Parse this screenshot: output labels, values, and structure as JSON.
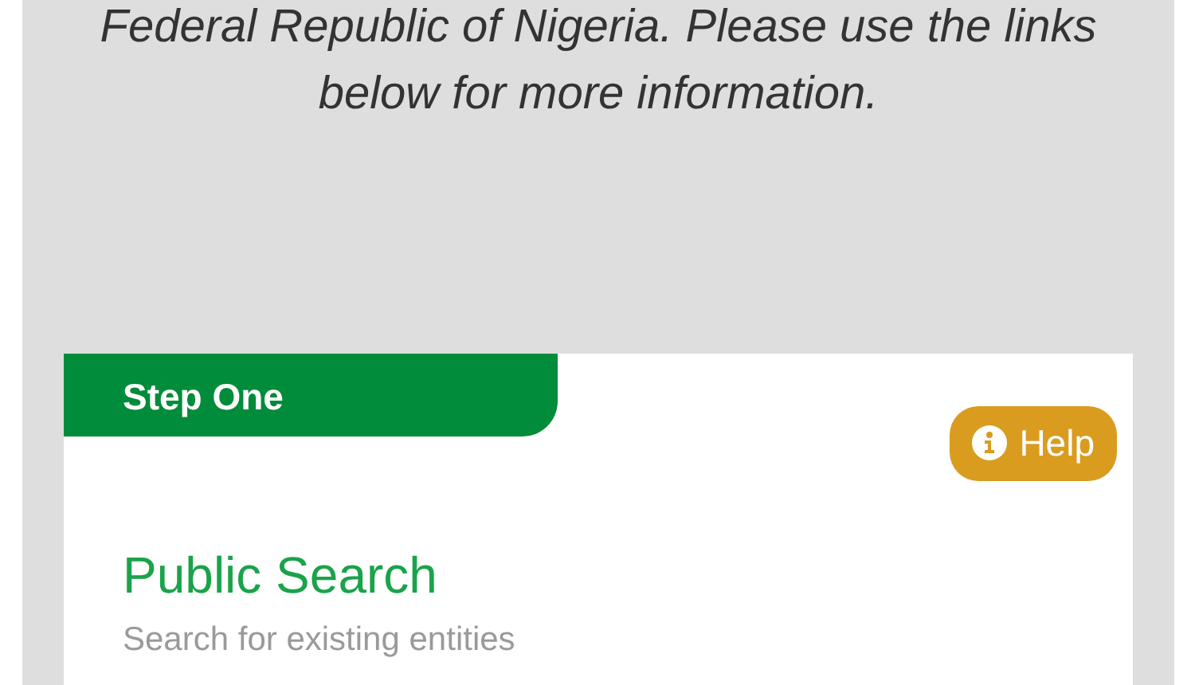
{
  "intro": {
    "text": "Federal Republic of Nigeria. Please use the links below for more information."
  },
  "card": {
    "step_label": "Step One",
    "help_button": {
      "label": "Help"
    },
    "title": "Public Search",
    "subtitle": "Search for existing entities"
  }
}
